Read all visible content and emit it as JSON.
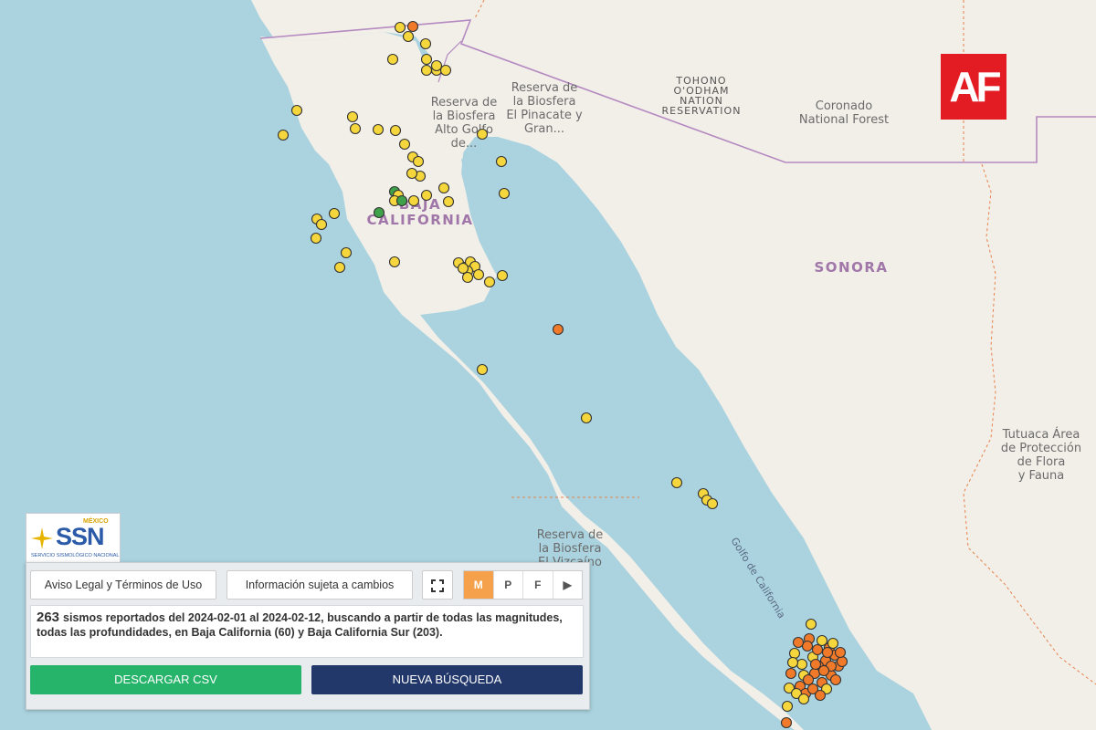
{
  "brand": {
    "af_logo": "AF"
  },
  "ssn_logo": {
    "top": "MÉXICO",
    "name": "SSN",
    "subtitle": "SERVICIO SISMOLÓGICO NACIONAL"
  },
  "map": {
    "labels": {
      "reserva_alto": [
        "Reserva de",
        "la Biosfera",
        "Alto Golfo",
        "de..."
      ],
      "reserva_pinacate": [
        "Reserva de",
        "la Biosfera",
        "El Pinacate y",
        "Gran..."
      ],
      "tohono": [
        "TOHONO",
        "O'ODHAM",
        "NATION",
        "RESERVATION"
      ],
      "coronado": [
        "Coronado",
        "National Forest"
      ],
      "baja": [
        "BAJA",
        "CALIFORNIA"
      ],
      "sonora": "SONORA",
      "tutuaca": [
        "Tutuaca Área",
        "de Protección",
        "de Flora",
        "y Fauna"
      ],
      "vizcaino": [
        "Reserva de",
        "la Biosfera",
        "El Vizcaíno"
      ],
      "golfo": "Golfo de California"
    },
    "legend_colors": {
      "yellow": "#f5d63c",
      "orange": "#f07a2a",
      "green": "#3fa24a"
    }
  },
  "toolbar": {
    "aviso": "Aviso Legal y Términos de Uso",
    "info": "Información sujeta a cambios",
    "fullscreen_icon": "fullscreen-icon",
    "tabs": [
      "M",
      "P",
      "F",
      "▶"
    ],
    "active_tab": "M"
  },
  "summary": {
    "count": "263",
    "text": "sismos reportados del 2024-02-01 al 2024-02-12, buscando a partir de todas las magnitudes, todas las profundidades, en Baja California (60) y Baja California Sur (203)."
  },
  "actions": {
    "csv": "DESCARGAR CSV",
    "new_search": "NUEVA BÚSQUEDA"
  }
}
